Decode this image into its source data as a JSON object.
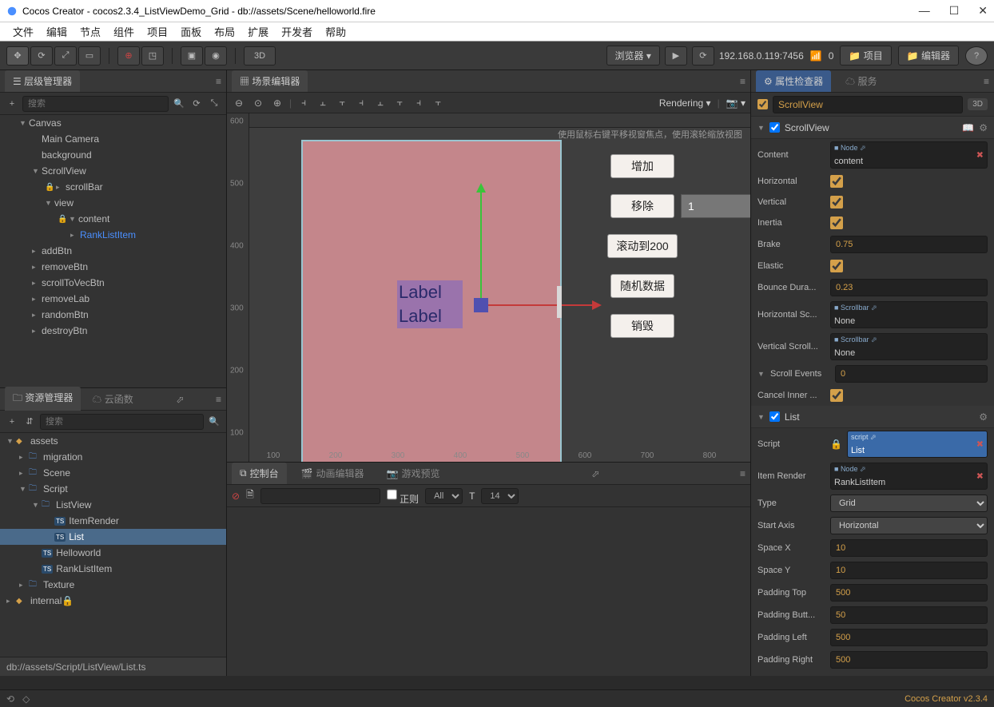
{
  "window": {
    "title": "Cocos Creator - cocos2.3.4_ListViewDemo_Grid - db://assets/Scene/helloworld.fire"
  },
  "menu": {
    "items": [
      "文件",
      "编辑",
      "节点",
      "组件",
      "项目",
      "面板",
      "布局",
      "扩展",
      "开发者",
      "帮助"
    ]
  },
  "toolbar": {
    "preview_dropdown": "浏览器",
    "mode_3d": "3D",
    "ip": "192.168.0.119:7456",
    "wifi_count": "0",
    "project_btn": "项目",
    "editor_btn": "编辑器"
  },
  "panels": {
    "hierarchy": "层级管理器",
    "scene": "场景编辑器",
    "assets": "资源管理器",
    "cloud": "云函数",
    "console": "控制台",
    "anim": "动画编辑器",
    "game": "游戏预览",
    "inspector": "属性检查器",
    "service": "服务",
    "search_placeholder": "搜索"
  },
  "hierarchy_tree": {
    "Canvas": "Canvas",
    "MainCamera": "Main Camera",
    "background": "background",
    "ScrollView": "ScrollView",
    "scrollBar": "scrollBar",
    "view": "view",
    "content": "content",
    "RankListItem": "RankListItem",
    "addBtn": "addBtn",
    "removeBtn": "removeBtn",
    "scrollToVecBtn": "scrollToVecBtn",
    "removeLab": "removeLab",
    "randomBtn": "randomBtn",
    "destroyBtn": "destroyBtn"
  },
  "assets_tree": {
    "assets": "assets",
    "migration": "migration",
    "Scene": "Scene",
    "Script": "Script",
    "ListView": "ListView",
    "ItemRender": "ItemRender",
    "List": "List",
    "Helloworld": "Helloworld",
    "RankListItem": "RankListItem",
    "Texture": "Texture",
    "internal": "internal"
  },
  "scene": {
    "hint": "使用鼠标右键平移视窗焦点，使用滚轮缩放视图",
    "rendering": "Rendering",
    "btn_add": "增加",
    "btn_remove": "移除",
    "btn_scroll200": "滚动到200",
    "btn_random": "随机数据",
    "btn_destroy": "销毁",
    "input_remove": "1",
    "label1": "Label",
    "label2": "Label",
    "ruler_h": [
      "100",
      "200",
      "300",
      "400",
      "500",
      "600",
      "700",
      "800"
    ],
    "ruler_v": [
      "600",
      "500",
      "400",
      "300",
      "200",
      "100"
    ]
  },
  "console_tb": {
    "regex_chk": "正则",
    "filter_all": "All",
    "font_size": "14"
  },
  "inspector": {
    "node_name": "ScrollView",
    "badge_3d": "3D",
    "comp_scrollview": "ScrollView",
    "content_label": "Content",
    "content_tag": "Node",
    "content_val": "content",
    "horizontal": "Horizontal",
    "vertical": "Vertical",
    "inertia": "Inertia",
    "brake": "Brake",
    "brake_val": "0.75",
    "elastic": "Elastic",
    "bounce": "Bounce Dura...",
    "bounce_val": "0.23",
    "hscroll": "Horizontal Sc...",
    "scrollbar_tag": "Scrollbar",
    "none": "None",
    "vscroll": "Vertical Scroll...",
    "scroll_events": "Scroll Events",
    "scroll_events_val": "0",
    "cancel_inner": "Cancel Inner ...",
    "comp_list": "List",
    "script_label": "Script",
    "script_tag": "script",
    "script_val": "List",
    "item_render": "Item Render",
    "item_render_tag": "Node",
    "item_render_val": "RankListItem",
    "type": "Type",
    "type_val": "Grid",
    "start_axis": "Start Axis",
    "start_axis_val": "Horizontal",
    "space_x": "Space X",
    "space_x_val": "10",
    "space_y": "Space Y",
    "space_y_val": "10",
    "padding_top": "Padding Top",
    "padding_top_val": "500",
    "padding_bottom": "Padding Butt...",
    "padding_bottom_val": "50",
    "padding_left": "Padding Left",
    "padding_left_val": "500",
    "padding_right": "Padding Right",
    "padding_right_val": "500"
  },
  "asset_status": "db://assets/Script/ListView/List.ts",
  "footer_version": "Cocos Creator v2.3.4"
}
